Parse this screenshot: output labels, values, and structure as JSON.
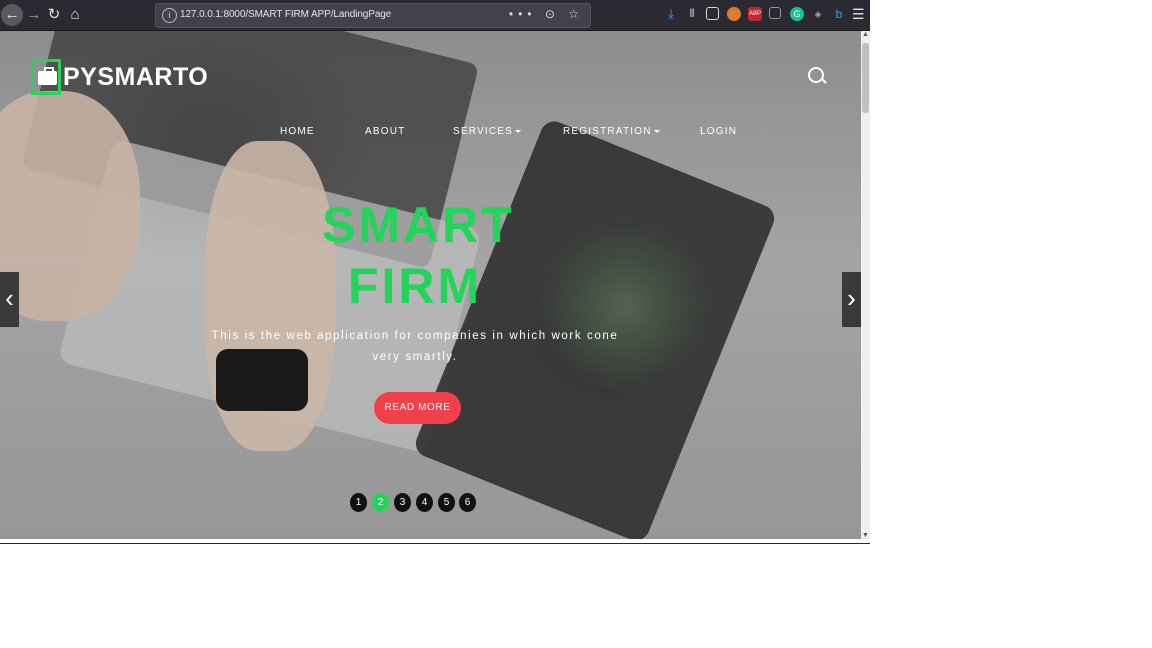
{
  "browser": {
    "url": "127.0.0.1:8000/SMART FIRM APP/LandingPage",
    "url_actions": "••• ⊙ ☆",
    "toolbar_icons": [
      "download-icon",
      "library-icon",
      "reader-icon",
      "extension-icon",
      "adblock-icon",
      "tab-icon",
      "grammarly-icon",
      "extension-icon",
      "bing-icon"
    ],
    "menu_icon": "hamburger-menu-icon"
  },
  "site": {
    "logo_text": "PYSMARTO",
    "nav": [
      {
        "label": "HOME",
        "dropdown": false
      },
      {
        "label": "ABOUT",
        "dropdown": false
      },
      {
        "label": "SERVICES",
        "dropdown": true
      },
      {
        "label": "REGISTRATION",
        "dropdown": true
      },
      {
        "label": "LOGIN",
        "dropdown": false
      }
    ],
    "hero": {
      "title_line1": "SMART",
      "title_line2": "FIRM",
      "subtitle": "This is the web application for companies in which work cone very smartly.",
      "cta": "READ MORE",
      "slides": [
        "1",
        "2",
        "3",
        "4",
        "5",
        "6"
      ],
      "active_slide": "2"
    },
    "colors": {
      "accent_green": "#22d45a",
      "cta_red": "#f0404b",
      "browser_chrome": "#2b2a33"
    }
  }
}
